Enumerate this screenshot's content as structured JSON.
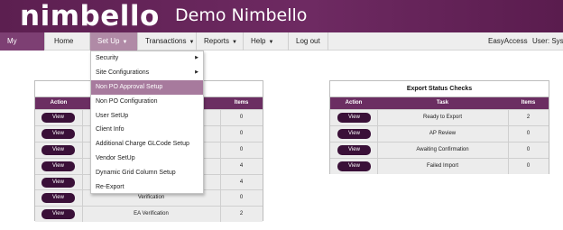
{
  "header": {
    "logo_text": "nimbello",
    "app_title": "Demo Nimbello"
  },
  "nav": {
    "items": [
      {
        "label": "My Tasks",
        "has_caret": false
      },
      {
        "label": "Home",
        "has_caret": false
      },
      {
        "label": "Set Up",
        "has_caret": true
      },
      {
        "label": "Transactions",
        "has_caret": true
      },
      {
        "label": "Reports",
        "has_caret": true
      },
      {
        "label": "Help",
        "has_caret": true
      },
      {
        "label": "Log out",
        "has_caret": false
      }
    ],
    "caret_icon": "▼",
    "easy_access": "EasyAccess",
    "user_label": "User: Syst"
  },
  "setup_menu": {
    "items": [
      {
        "label": "Security",
        "submenu": true
      },
      {
        "label": "Site Configurations",
        "submenu": true
      },
      {
        "label": "Non PO Approval Setup",
        "submenu": false,
        "highlighted": true
      },
      {
        "label": "Non PO Configuration",
        "submenu": false
      },
      {
        "label": "User SetUp",
        "submenu": false
      },
      {
        "label": "Client Info",
        "submenu": false
      },
      {
        "label": "Additional Charge GLCode Setup",
        "submenu": false
      },
      {
        "label": "Vendor SetUp",
        "submenu": false
      },
      {
        "label": "Dynamic Grid Column Setup",
        "submenu": false
      },
      {
        "label": "Re-Export",
        "submenu": false
      }
    ],
    "submenu_icon": "▶"
  },
  "task_panel": {
    "headers": {
      "action": "Action",
      "items": "Items"
    },
    "rows": [
      {
        "button": "View",
        "task": "",
        "count": "0"
      },
      {
        "button": "View",
        "task": "",
        "count": "0"
      },
      {
        "button": "View",
        "task": "",
        "count": "0"
      },
      {
        "button": "View",
        "task": "",
        "count": "4"
      },
      {
        "button": "View",
        "task": "",
        "count": "4"
      },
      {
        "button": "View",
        "task": "Verification",
        "count": "0"
      },
      {
        "button": "View",
        "task": "EA Verification",
        "count": "2"
      }
    ]
  },
  "export_panel": {
    "title": "Export Status Checks",
    "headers": {
      "action": "Action",
      "task": "Task",
      "items": "Items"
    },
    "rows": [
      {
        "button": "View",
        "task": "Ready to Export",
        "count": "2"
      },
      {
        "button": "View",
        "task": "AP Review",
        "count": "0"
      },
      {
        "button": "View",
        "task": "Awaiting Confirmation",
        "count": "0"
      },
      {
        "button": "View",
        "task": "Failed Import",
        "count": "0"
      }
    ]
  },
  "colors": {
    "brand": "#6b2e62",
    "button": "#3a1038",
    "menu_highlight": "#a77a9d",
    "active_tab": "#7d3f73"
  }
}
